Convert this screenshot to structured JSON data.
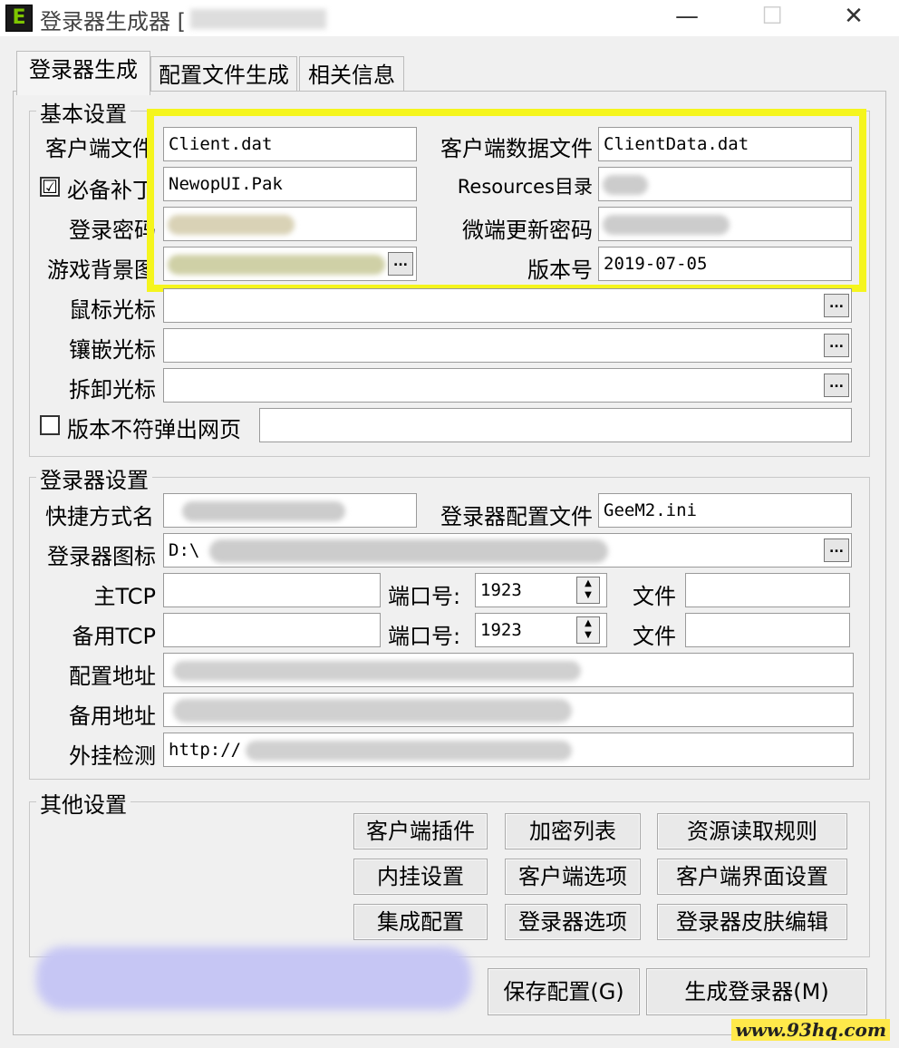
{
  "window": {
    "title": "登录器生成器 [",
    "app_icon_letter": "E",
    "minimize": "—",
    "maximize": "☐",
    "close": "✕"
  },
  "tabs": [
    "登录器生成",
    "配置文件生成",
    "相关信息"
  ],
  "basic": {
    "title": "基本设置",
    "client_file_label": "客户端文件",
    "client_file_value": "Client.dat",
    "client_data_label": "客户端数据文件",
    "client_data_value": "ClientData.dat",
    "patch_label": "必备补丁",
    "patch_checked": "☑",
    "patch_value": "NewopUI.Pak",
    "resources_label": "Resources目录",
    "login_pwd_label": "登录密码",
    "micro_pwd_label": "微端更新密码",
    "bg_label": "游戏背景图",
    "version_label": "版本号",
    "version_value": "2019-07-05",
    "mouse_cursor_label": "鼠标光标",
    "inlay_cursor_label": "镶嵌光标",
    "dismantle_cursor_label": "拆卸光标",
    "mismatch_popup_label": "版本不符弹出网页",
    "mismatch_checked": ""
  },
  "launcher": {
    "title": "登录器设置",
    "shortcut_label": "快捷方式名",
    "config_file_label": "登录器配置文件",
    "config_file_value": "GeeM2.ini",
    "icon_label": "登录器图标",
    "icon_value": "D:\\",
    "main_tcp_label": "主TCP",
    "port_label": "端口号:",
    "main_port": "1923",
    "file_label": "文件",
    "backup_tcp_label": "备用TCP",
    "backup_port": "1923",
    "config_addr_label": "配置地址",
    "backup_addr_label": "备用地址",
    "plugin_check_label": "外挂检测",
    "plugin_check_value": "http://"
  },
  "other": {
    "title": "其他设置",
    "buttons": [
      "客户端插件",
      "加密列表",
      "资源读取规则",
      "内挂设置",
      "客户端选项",
      "客户端界面设置",
      "集成配置",
      "登录器选项",
      "登录器皮肤编辑"
    ]
  },
  "actions": {
    "save": "保存配置(G)",
    "generate": "生成登录器(M)"
  },
  "ellipsis": "...",
  "watermark": "www.93hq.com",
  "colors": {
    "highlight": "#f5f51d"
  }
}
